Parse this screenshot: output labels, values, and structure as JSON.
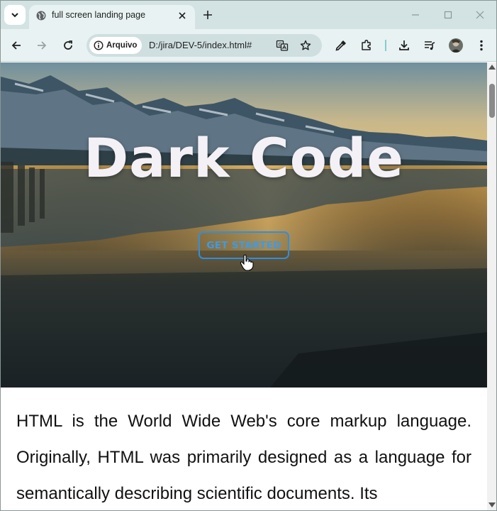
{
  "browser": {
    "tab_title": "full screen landing page",
    "address_chip": "Arquivo",
    "url": "D:/jira/DEV-5/index.html#",
    "accent": "#d3e3e4"
  },
  "hero": {
    "title": "Dark Code",
    "cta_label": "GET STARTED",
    "cta_color": "#2f8fe0"
  },
  "content": {
    "paragraph": "HTML is the World Wide Web's core markup language. Originally, HTML was primarily designed as a language for semantically describing scientific documents. Its"
  }
}
